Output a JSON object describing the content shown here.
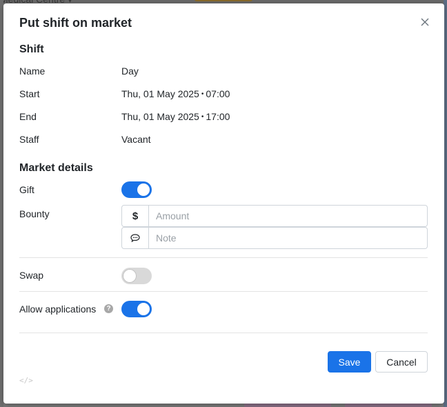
{
  "background": {
    "crumb": "Medical Centre ▾"
  },
  "modal": {
    "title": "Put shift on market",
    "close_icon": "close-icon"
  },
  "shift": {
    "section_title": "Shift",
    "name_label": "Name",
    "name_value": "Day",
    "start_label": "Start",
    "start_date": "Thu, 01 May 2025",
    "start_time": "07:00",
    "end_label": "End",
    "end_date": "Thu, 01 May 2025",
    "end_time": "17:00",
    "staff_label": "Staff",
    "staff_value": "Vacant",
    "separator": "•"
  },
  "market": {
    "section_title": "Market details",
    "gift_label": "Gift",
    "gift_on": true,
    "bounty_label": "Bounty",
    "currency_symbol": "$",
    "amount_placeholder": "Amount",
    "amount_value": "",
    "note_icon": "speech-bubble-icon",
    "note_placeholder": "Note",
    "note_value": "",
    "swap_label": "Swap",
    "swap_on": false,
    "allow_applications_label": "Allow applications",
    "allow_applications_on": true,
    "help_icon": "?"
  },
  "footer": {
    "save_label": "Save",
    "cancel_label": "Cancel",
    "code_icon": "</>"
  },
  "colors": {
    "primary": "#1a73e8",
    "toggle_off": "#d9d9d9"
  }
}
